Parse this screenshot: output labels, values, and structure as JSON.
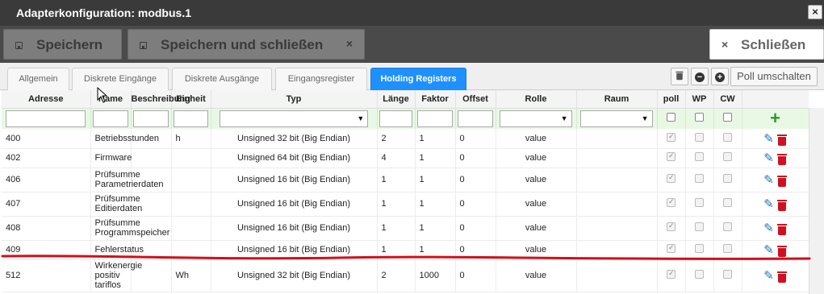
{
  "window": {
    "title": "Adapterkonfiguration: modbus.1",
    "close_glyph": "×"
  },
  "toolbar": {
    "save_label": "Speichern",
    "save_close_label": "Speichern und schließen",
    "save_close_x": "×",
    "close_label": "Schließen",
    "close_x": "×"
  },
  "tabs": [
    {
      "label": "Allgemein",
      "active": false
    },
    {
      "label": "Diskrete Eingänge",
      "active": false
    },
    {
      "label": "Diskrete Ausgänge",
      "active": false
    },
    {
      "label": "Eingangsregister",
      "active": false
    },
    {
      "label": "Holding Registers",
      "active": true
    }
  ],
  "tab_tools": {
    "trash_icon": "trash-icon",
    "minus_glyph": "−",
    "plus_glyph": "+",
    "poll_toggle_label": "Poll umschalten"
  },
  "columns": [
    "Adresse",
    "Name",
    "Beschreibung",
    "Einheit",
    "Typ",
    "Länge",
    "Faktor",
    "Offset",
    "Rolle",
    "Raum",
    "poll",
    "WP",
    "CW"
  ],
  "add_glyph": "+",
  "rows": [
    {
      "adresse": "400",
      "name": "Betriebsstunden",
      "beschreibung": "",
      "einheit": "h",
      "typ": "Unsigned 32 bit (Big Endian)",
      "laenge": "2",
      "faktor": "1",
      "offset": "0",
      "rolle": "value",
      "raum": "",
      "poll": true,
      "wp": false,
      "cw": false
    },
    {
      "adresse": "402",
      "name": "Firmware",
      "beschreibung": "",
      "einheit": "",
      "typ": "Unsigned 64 bit (Big Endian)",
      "laenge": "4",
      "faktor": "1",
      "offset": "0",
      "rolle": "value",
      "raum": "",
      "poll": true,
      "wp": false,
      "cw": false
    },
    {
      "adresse": "406",
      "name": "Prüfsumme Parametrierdaten",
      "beschreibung": "",
      "einheit": "",
      "typ": "Unsigned 16 bit (Big Endian)",
      "laenge": "1",
      "faktor": "1",
      "offset": "0",
      "rolle": "value",
      "raum": "",
      "poll": true,
      "wp": false,
      "cw": false
    },
    {
      "adresse": "407",
      "name": "Prüfsumme Editierdaten",
      "beschreibung": "",
      "einheit": "",
      "typ": "Unsigned 16 bit (Big Endian)",
      "laenge": "1",
      "faktor": "1",
      "offset": "0",
      "rolle": "value",
      "raum": "",
      "poll": true,
      "wp": false,
      "cw": false
    },
    {
      "adresse": "408",
      "name": "Prüfsumme Programmspeicher",
      "beschreibung": "",
      "einheit": "",
      "typ": "Unsigned 16 bit (Big Endian)",
      "laenge": "1",
      "faktor": "1",
      "offset": "0",
      "rolle": "value",
      "raum": "",
      "poll": true,
      "wp": false,
      "cw": false
    },
    {
      "adresse": "409",
      "name": "Fehlerstatus",
      "beschreibung": "",
      "einheit": "",
      "typ": "Unsigned 16 bit (Big Endian)",
      "laenge": "1",
      "faktor": "1",
      "offset": "0",
      "rolle": "value",
      "raum": "",
      "poll": true,
      "wp": false,
      "cw": false
    },
    {
      "adresse": "512",
      "name": "Wirkenergie positiv tariflos",
      "beschreibung": "",
      "einheit": "Wh",
      "typ": "Unsigned 32 bit (Big Endian)",
      "laenge": "2",
      "faktor": "1000",
      "offset": "0",
      "rolle": "value",
      "raum": "",
      "poll": true,
      "wp": false,
      "cw": false
    }
  ],
  "colors": {
    "active_tab": "#1e90ff",
    "filter_row": "#e8f8e4",
    "delete_red": "#d01020",
    "edit_blue": "#1f6fb8",
    "annotation_red": "#d0101a"
  }
}
